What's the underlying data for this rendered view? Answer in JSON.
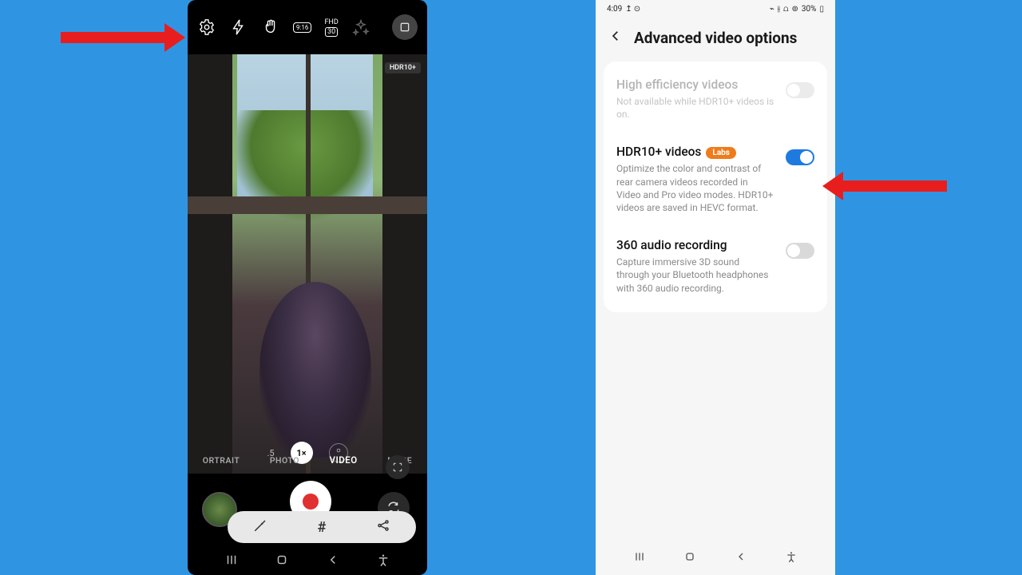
{
  "camera": {
    "hdr_badge": "HDR10+",
    "ratio_label": "9:16",
    "fhd_label_top": "FHD",
    "fhd_label_box": "30",
    "zoom": {
      "left": ".5",
      "mid": "1×",
      "right": ""
    },
    "modes": {
      "portrait": "ORTRAIT",
      "photo": "PHOTO",
      "video": "VIDEO",
      "more": "MORE"
    },
    "overlay": {
      "hash": "#"
    }
  },
  "settings": {
    "status": {
      "time": "4:09",
      "battery": "30%"
    },
    "header": "Advanced video options",
    "rows": [
      {
        "title": "High efficiency videos",
        "desc": "Not available while HDR10+ videos is on.",
        "enabled": false,
        "on": false
      },
      {
        "title": "HDR10+ videos",
        "badge": "Labs",
        "desc": "Optimize the color and contrast of rear camera videos recorded in Video and Pro video modes. HDR10+ videos are saved in HEVC format.",
        "enabled": true,
        "on": true
      },
      {
        "title": "360 audio recording",
        "desc": "Capture immersive 3D sound through your Bluetooth headphones with 360 audio recording.",
        "enabled": true,
        "on": false
      }
    ]
  }
}
